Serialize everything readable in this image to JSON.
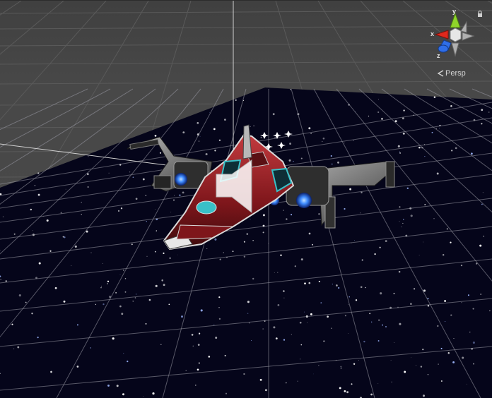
{
  "scene_view": {
    "colors": {
      "background": "#4a4a4a",
      "space_floor": "#05051a",
      "grid_line": "#c8c8c8",
      "ship_hull": "#8a1b20",
      "ship_trim": "#d8d8d8",
      "engine_glow": "#3f8cff",
      "cockpit": "#39c0c8",
      "axis_x": "#e0281c",
      "axis_y": "#8fd42a",
      "axis_z": "#2f6ee8"
    },
    "selected_object": {
      "icon": "audio-source-gizmo-icon"
    }
  },
  "orientation_gizmo": {
    "axis_x_label": "x",
    "axis_y_label": "y",
    "axis_z_label": "z",
    "lock_icon": "lock-icon",
    "projection_label": "Persp",
    "projection_icon": "perspective-chevron-icon"
  }
}
